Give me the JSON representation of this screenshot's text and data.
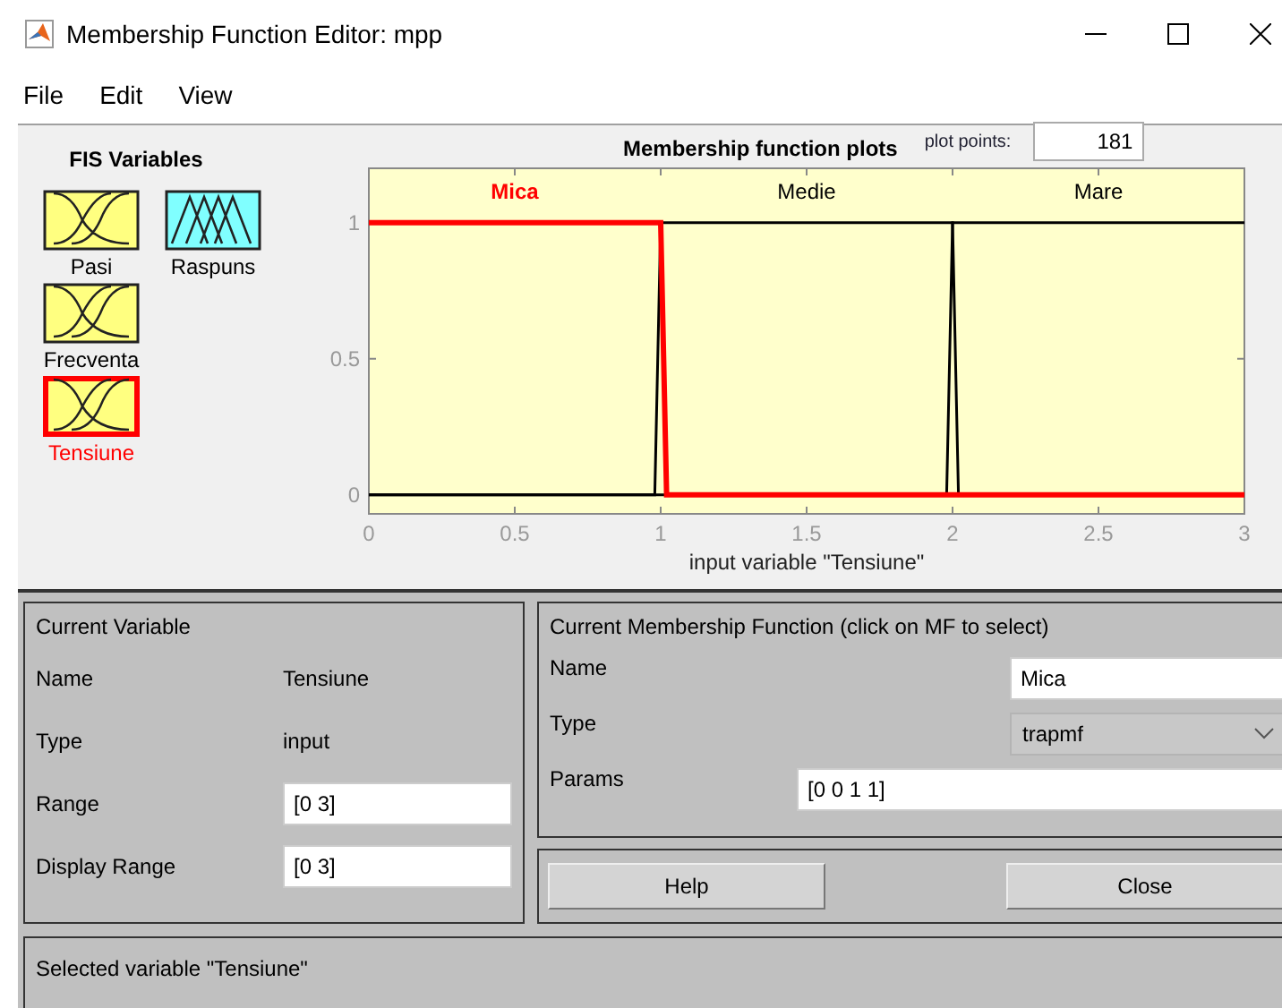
{
  "window": {
    "title": "Membership Function Editor: mpp"
  },
  "menu": [
    "File",
    "Edit",
    "View"
  ],
  "fis_variables": {
    "title": "FIS Variables",
    "inputs": [
      {
        "name": "Pasi",
        "kind": "input",
        "selected": false
      },
      {
        "name": "Frecventa",
        "kind": "input",
        "selected": false
      },
      {
        "name": "Tensiune",
        "kind": "input",
        "selected": true
      }
    ],
    "outputs": [
      {
        "name": "Raspuns",
        "kind": "output",
        "selected": false
      }
    ]
  },
  "plot": {
    "title": "Membership function plots",
    "plot_points_label": "plot points:",
    "plot_points": "181",
    "chart_data": {
      "type": "line",
      "xlabel": "input variable \"Tensiune\"",
      "x": [
        0,
        0.98,
        1,
        1.02,
        1.98,
        2,
        2.02,
        3
      ],
      "series": [
        {
          "name": "Mica",
          "color": "#ff0000",
          "values": [
            1,
            1,
            1,
            0,
            0,
            0,
            0,
            0
          ]
        },
        {
          "name": "Medie",
          "color": "#000000",
          "values": [
            0,
            0,
            1,
            1,
            1,
            1,
            0,
            0
          ]
        },
        {
          "name": "Mare",
          "color": "#000000",
          "values": [
            0,
            0,
            0,
            0,
            0,
            1,
            1,
            1
          ]
        }
      ],
      "xlim": [
        0,
        3
      ],
      "ylim": [
        -0.07,
        1.2
      ],
      "xticks": [
        0,
        0.5,
        1,
        1.5,
        2,
        2.5,
        3
      ],
      "yticks": [
        0,
        0.5,
        1
      ]
    }
  },
  "current_variable": {
    "title": "Current Variable",
    "name_label": "Name",
    "name": "Tensiune",
    "type_label": "Type",
    "type": "input",
    "range_label": "Range",
    "range": "[0 3]",
    "display_range_label": "Display Range",
    "display_range": "[0 3]"
  },
  "current_mf": {
    "title": "Current Membership Function (click on MF to select)",
    "name_label": "Name",
    "name": "Mica",
    "type_label": "Type",
    "type": "trapmf",
    "params_label": "Params",
    "params": "[0 0 1 1]"
  },
  "buttons": [
    "Help",
    "Close"
  ],
  "status": "Selected variable \"Tensiune\""
}
